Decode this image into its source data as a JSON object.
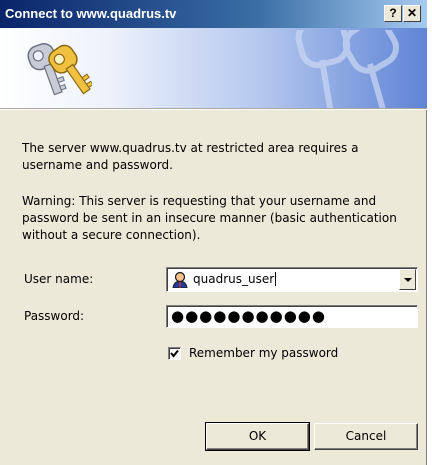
{
  "dialog": {
    "title": "Connect to www.quadrus.tv",
    "help_label": "?",
    "close_label": "✕",
    "message": "The server www.quadrus.tv at restricted area requires a username and password.",
    "warning": "Warning: This server is requesting that your username and password be sent in an insecure manner (basic authentication without a secure connection).",
    "username_label": "User name:",
    "username_value": "quadrus_user",
    "password_label": "Password:",
    "password_value": "●●●●●●●●●●●",
    "remember_label": "Remember my password",
    "remember_checked": true,
    "ok_label": "OK",
    "cancel_label": "Cancel"
  },
  "icons": [
    "keys-icon",
    "keys-watermark-icon",
    "user-icon",
    "chevron-down-icon",
    "checkmark-icon"
  ],
  "colors": {
    "title_bar": "#0a246a",
    "dialog_bg": "#ece9d8",
    "banner_accent": "#5f84d6"
  }
}
